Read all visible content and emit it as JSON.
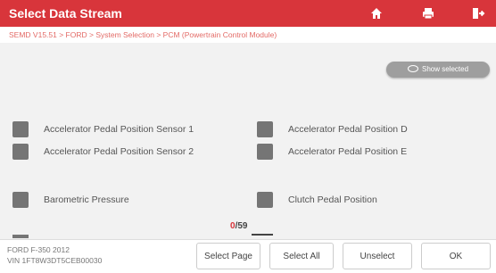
{
  "header": {
    "title": "Select Data Stream",
    "icons": [
      "home-icon",
      "print-icon",
      "exit-icon"
    ]
  },
  "breadcrumb": "SEMD V15.51 > FORD > System Selection > PCM (Powertrain Control Module)",
  "show_selected_label": "Show selected",
  "items": [
    {
      "label": "Accelerator Pedal Position Sensor 1",
      "checked": false
    },
    {
      "label": "Accelerator Pedal Position D",
      "checked": false
    },
    {
      "label": "Accelerator Pedal Position Sensor 2",
      "checked": false
    },
    {
      "label": "Accelerator Pedal Position E",
      "checked": false
    },
    {
      "label": "Barometric Pressure",
      "checked": false
    },
    {
      "label": "Clutch Pedal Position",
      "checked": false
    }
  ],
  "pager": {
    "selected": "0",
    "separator": "/",
    "total": "59"
  },
  "vehicle": {
    "line1": "FORD F-350 2012",
    "line2": "VIN 1FT8W3DT5CEB00030"
  },
  "buttons": {
    "select_page": "Select Page",
    "select_all": "Select All",
    "unselect": "Unselect",
    "ok": "OK"
  },
  "colors": {
    "accent": "#d8353b",
    "checkbox": "#757575"
  }
}
